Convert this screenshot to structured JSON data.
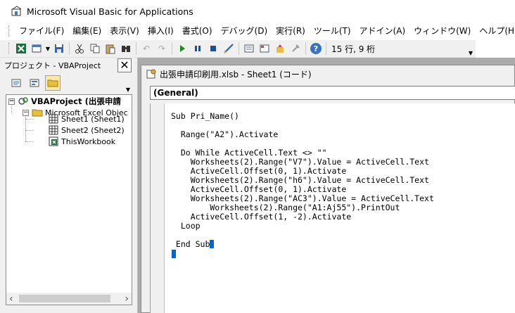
{
  "app": {
    "title": "Microsoft Visual Basic for Applications"
  },
  "menus": [
    {
      "label": "ファイル(F)"
    },
    {
      "label": "編集(E)"
    },
    {
      "label": "表示(V)"
    },
    {
      "label": "挿入(I)"
    },
    {
      "label": "書式(O)"
    },
    {
      "label": "デバッグ(D)"
    },
    {
      "label": "実行(R)"
    },
    {
      "label": "ツール(T)"
    },
    {
      "label": "アドイン(A)"
    },
    {
      "label": "ウィンドウ(W)"
    },
    {
      "label": "ヘルプ(H)"
    }
  ],
  "toolbar": {
    "status": "15 行, 9 桁",
    "icons": [
      "view-excel-icon",
      "insert-module-icon",
      "save-icon",
      "cut-icon",
      "copy-icon",
      "paste-icon",
      "find-icon",
      "undo-icon",
      "redo-icon",
      "run-icon",
      "break-icon",
      "reset-icon",
      "design-mode-icon",
      "project-explorer-icon",
      "properties-icon",
      "object-browser-icon",
      "toolbox-icon",
      "help-icon"
    ]
  },
  "project_pane": {
    "title": "プロジェクト - VBAProject",
    "tree": {
      "project": "VBAProject (出張申請",
      "folder": "Microsoft Excel Objec",
      "items": [
        "Sheet1 (Sheet1)",
        "Sheet2 (Sheet2)",
        "ThisWorkbook"
      ]
    }
  },
  "code_window": {
    "title": "出張申請印刷用.xlsb - Sheet1 (コード)",
    "object_selector": "(General)",
    "lines": [
      "Sub Pri_Name()",
      "",
      "  Range(\"A2\").Activate",
      "",
      "  Do While ActiveCell.Text <> \"\"",
      "    Worksheets(2).Range(\"V7\").Value = ActiveCell.Text",
      "    ActiveCell.Offset(0, 1).Activate",
      "    Worksheets(2).Range(\"h6\").Value = ActiveCell.Text",
      "    ActiveCell.Offset(0, 1).Activate",
      "    Worksheets(2).Range(\"AC3\").Value = ActiveCell.Text",
      "        Worksheets(2).Range(\"A1:Aj55\").PrintOut",
      "    ActiveCell.Offset(1, -2).Activate",
      "  Loop",
      "",
      " End Sub"
    ]
  }
}
